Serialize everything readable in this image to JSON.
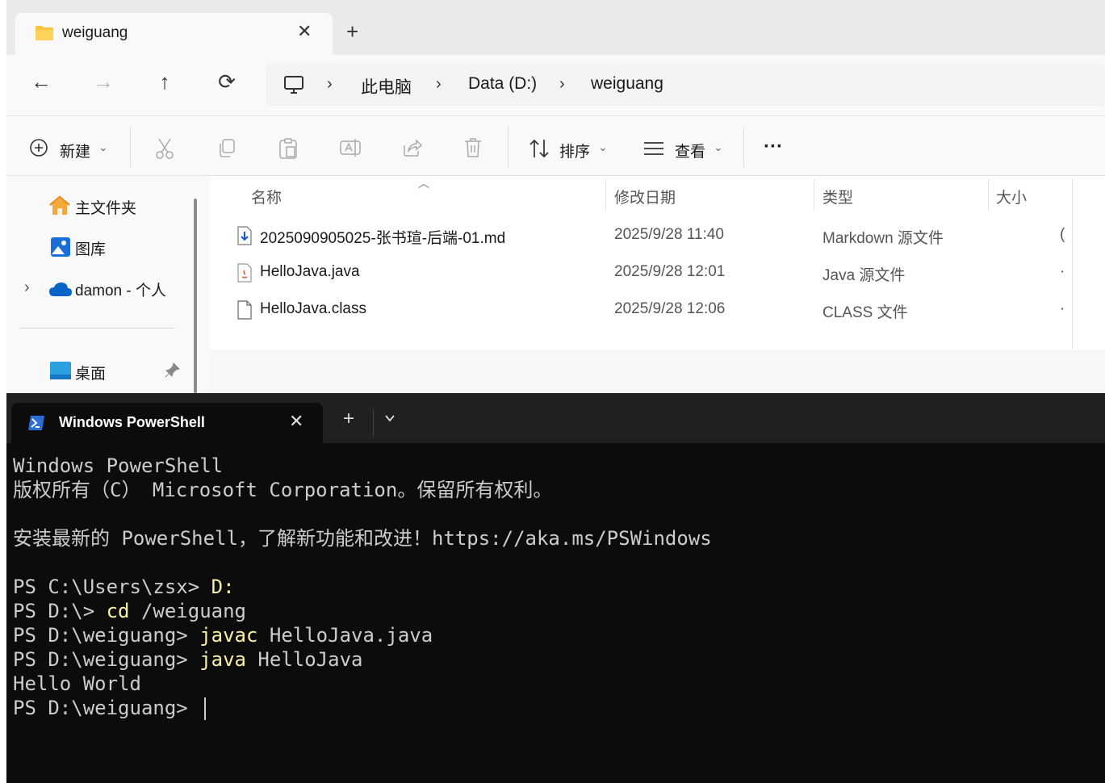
{
  "explorer": {
    "tab": {
      "title": "weiguang",
      "close": "✕",
      "new_tab": "+"
    },
    "nav": {
      "back": "←",
      "forward": "→",
      "up": "↑",
      "refresh": "⟳"
    },
    "breadcrumb": [
      "此电脑",
      "Data (D:)",
      "weiguang"
    ],
    "breadcrumb_sep": "›",
    "commands": {
      "new": "新建",
      "sort": "排序",
      "view": "查看",
      "more": "···"
    },
    "sidebar": [
      {
        "label": "主文件夹",
        "icon": "home-icon"
      },
      {
        "label": "图库",
        "icon": "gallery-icon"
      },
      {
        "label": "damon - 个人",
        "icon": "onedrive-cloud-icon"
      },
      {
        "label": "桌面",
        "icon": "desktop-icon"
      }
    ],
    "sidebar_expand": "›",
    "columns": {
      "name": "名称",
      "date": "修改日期",
      "type": "类型",
      "size": "大小"
    },
    "files": [
      {
        "name": "2025090905025-张书瑄-后端-01.md",
        "date": "2025/9/28 11:40",
        "type": "Markdown 源文件",
        "size": "(",
        "icon": "markdown-file-icon"
      },
      {
        "name": "HelloJava.java",
        "date": "2025/9/28 12:01",
        "type": "Java 源文件",
        "size": "·",
        "icon": "java-file-icon"
      },
      {
        "name": "HelloJava.class",
        "date": "2025/9/28 12:06",
        "type": "CLASS 文件",
        "size": "·",
        "icon": "file-icon"
      }
    ]
  },
  "terminal": {
    "tab": {
      "title": "Windows PowerShell",
      "close": "✕",
      "new_tab": "+"
    },
    "lines": [
      [
        {
          "t": "Windows PowerShell"
        }
      ],
      [
        {
          "t": "版权所有（C） Microsoft Corporation。保留所有权利。"
        }
      ],
      [
        {
          "t": ""
        }
      ],
      [
        {
          "t": "安装最新的 PowerShell，了解新功能和改进！https://aka.ms/PSWindows"
        }
      ],
      [
        {
          "t": ""
        }
      ],
      [
        {
          "t": "PS C:\\Users\\zsx> "
        },
        {
          "t": "D:",
          "c": "cmd"
        }
      ],
      [
        {
          "t": "PS D:\\> "
        },
        {
          "t": "cd",
          "c": "cmd"
        },
        {
          "t": " /weiguang"
        }
      ],
      [
        {
          "t": "PS D:\\weiguang> "
        },
        {
          "t": "javac",
          "c": "cmd"
        },
        {
          "t": " HelloJava.java"
        }
      ],
      [
        {
          "t": "PS D:\\weiguang> "
        },
        {
          "t": "java",
          "c": "cmd"
        },
        {
          "t": " HelloJava"
        }
      ],
      [
        {
          "t": "Hello World"
        }
      ],
      [
        {
          "t": "PS D:\\weiguang> "
        }
      ]
    ]
  },
  "colors": {
    "terminal_bg": "#0c0c0c",
    "terminal_fg": "#cccccc",
    "command": "#f9f1a5",
    "folder": "#f8c43a",
    "accent": "#0067c0"
  }
}
